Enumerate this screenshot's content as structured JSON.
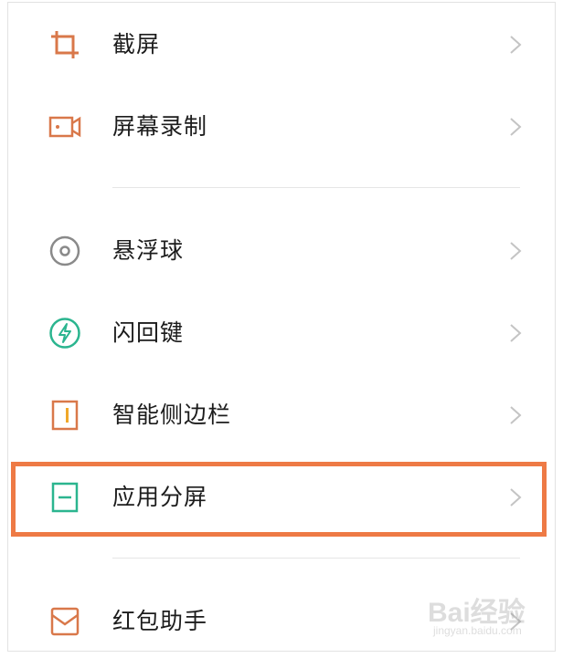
{
  "menu": {
    "items": [
      {
        "label": "截屏",
        "icon": "crop-icon"
      },
      {
        "label": "屏幕录制",
        "icon": "screen-record-icon"
      },
      {
        "label": "悬浮球",
        "icon": "floating-ball-icon"
      },
      {
        "label": "闪回键",
        "icon": "flashback-key-icon"
      },
      {
        "label": "智能侧边栏",
        "icon": "smart-sidebar-icon"
      },
      {
        "label": "应用分屏",
        "icon": "split-screen-icon",
        "highlighted": true
      },
      {
        "label": "红包助手",
        "icon": "red-envelope-icon"
      }
    ]
  },
  "colors": {
    "orange_icon": "#d9784a",
    "green_icon": "#2bb58f",
    "gray_icon": "#8a8a8a",
    "highlight_border": "#ee7a45",
    "chevron": "#c4c4c4"
  },
  "watermark": {
    "main": "Bai经验",
    "sub": "jingyan.baidu.com"
  }
}
